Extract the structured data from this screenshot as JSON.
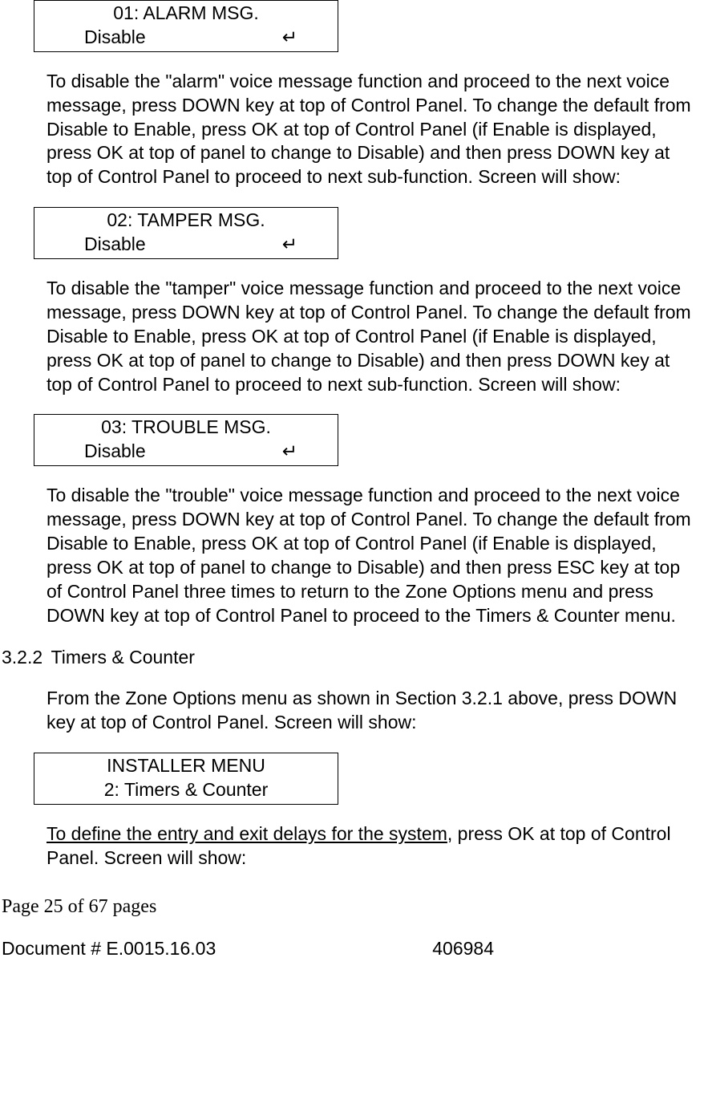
{
  "lcd1": {
    "line1": "01: ALARM MSG.",
    "line2_left": "Disable",
    "line2_right": "↵"
  },
  "para1": "To disable the \"alarm\" voice message function and proceed to the next voice message, press DOWN key at top of Control Panel. To change the default from Disable to Enable, press OK at top of Control Panel (if Enable is displayed, press OK at top of panel to change to Disable) and then press DOWN key at top of Control Panel to proceed to next sub-function. Screen will show:",
  "lcd2": {
    "line1": "02: TAMPER MSG.",
    "line2_left": "Disable",
    "line2_right": "↵"
  },
  "para2": "To disable the \"tamper\" voice message function and proceed to the next voice message, press DOWN key at top of Control Panel. To change the default from Disable to Enable, press OK at top of Control Panel (if Enable is displayed, press OK at top of panel to change to Disable) and then press DOWN key at top of Control Panel to proceed to next sub-function. Screen will show:",
  "lcd3": {
    "line1": "03: TROUBLE MSG.",
    "line2_left": "Disable",
    "line2_right": "↵"
  },
  "para3": "To disable the \"trouble\" voice message function and proceed to the next voice message, press DOWN key at top of Control Panel. To change the default from Disable to Enable, press OK at top of Control Panel (if Enable is displayed, press OK at top of panel to change to Disable) and then press ESC key at top of Control Panel three times to return to the Zone Options menu and press DOWN key at top of Control Panel to proceed to the Timers & Counter menu.",
  "section": {
    "num": "3.2.2",
    "title": "Timers & Counter"
  },
  "para4": "From the Zone Options menu as shown in Section 3.2.1 above, press DOWN key at top of Control Panel. Screen will show:",
  "lcd4": {
    "line1": "INSTALLER MENU",
    "line2": "2: Timers & Counter"
  },
  "para5": {
    "underlined": "To define the entry and exit delays for the system",
    "rest": ", press OK at top of Control Panel. Screen will show:"
  },
  "footer": {
    "pages": "Page 25 of  67 pages",
    "doc_left": "Document # E.0015.16.03",
    "doc_right": "406984"
  }
}
